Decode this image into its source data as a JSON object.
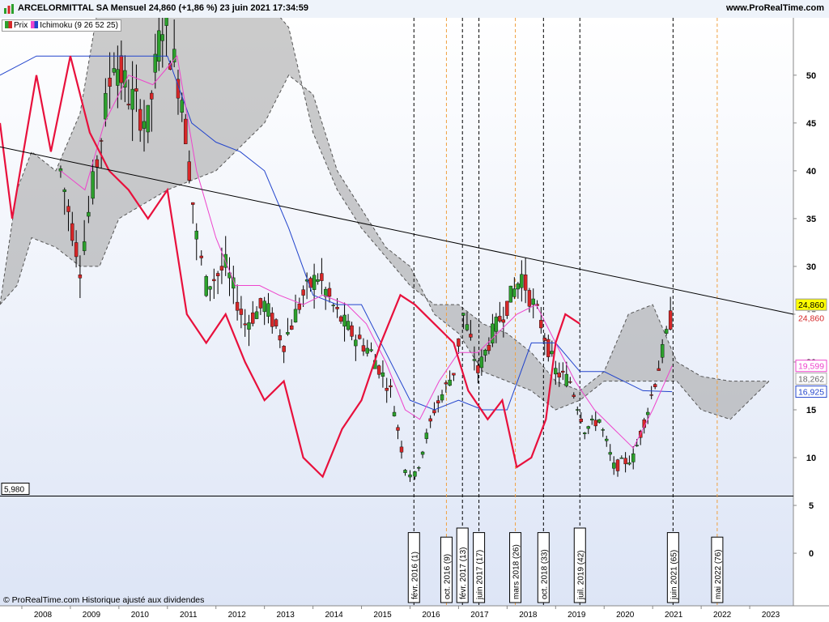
{
  "header": {
    "title": "ARCELORMITTAL SA Mensuel 24,860 (+1,86 %) 23 juin 2021 17:34:59",
    "site": "www.ProRealTime.com",
    "copyright": "© ProRealTime.com Historique ajusté aux dividendes"
  },
  "legend": {
    "price": "Prix",
    "ichimoku": "Ichimoku (9 26 52 25)"
  },
  "colors": {
    "up": "#2ca02c",
    "down": "#d62728",
    "tenkan": "#ee44cc",
    "kijun": "#2244cc",
    "chikou": "#e8103c",
    "cloud": "#a0a0a0",
    "trendline": "#000000",
    "vline": "#000000",
    "vline_future": "#f0a040"
  },
  "chart_data": {
    "type": "candlestick",
    "title": "ARCELORMITTAL SA Mensuel",
    "y_axis": {
      "range": [
        -5.5,
        56
      ],
      "ticks": [
        0,
        5,
        10,
        15,
        20,
        25,
        30,
        35,
        40,
        45,
        50
      ]
    },
    "x_axis": {
      "range": [
        2007.55,
        2023.9
      ],
      "ticks": [
        "2008",
        "2009",
        "2010",
        "2011",
        "2012",
        "2013",
        "2014",
        "2015",
        "2016",
        "2017",
        "2018",
        "2019",
        "2020",
        "2021",
        "2022",
        "2023"
      ]
    },
    "value_labels": [
      {
        "text": "24,860",
        "value": 26.0,
        "bg": "#ffff00",
        "fg": "#000000",
        "border": "#999999"
      },
      {
        "text": "24,860",
        "value": 24.6,
        "bg": "#ffffff",
        "fg": "#d62728",
        "border": "#ffffff"
      },
      {
        "text": "19,599",
        "value": 19.6,
        "bg": "#ffffff",
        "fg": "#ee44cc",
        "border": "#ee44cc"
      },
      {
        "text": "18,262",
        "value": 18.26,
        "bg": "#ffffff",
        "fg": "#666666",
        "border": "#aaaaaa"
      },
      {
        "text": "16,925",
        "value": 16.9,
        "bg": "#ffffff",
        "fg": "#2244cc",
        "border": "#2244cc"
      }
    ],
    "support": {
      "label": "5,980",
      "value": 5.98
    },
    "trendline": [
      [
        2007.55,
        42.5
      ],
      [
        2023.9,
        25.0
      ]
    ],
    "events": [
      {
        "label": "févr. 2016 (1)",
        "x": 2016.08,
        "future": false
      },
      {
        "label": "oct. 2016 (9)",
        "x": 2016.75,
        "future": true
      },
      {
        "label": "févr. 2017 (13)",
        "x": 2017.08,
        "future": false
      },
      {
        "label": "juin 2017 (17)",
        "x": 2017.42,
        "future": false
      },
      {
        "label": "mars 2018 (26)",
        "x": 2018.17,
        "future": true
      },
      {
        "label": "oct. 2018 (33)",
        "x": 2018.75,
        "future": false
      },
      {
        "label": "juil. 2019 (42)",
        "x": 2019.5,
        "future": false
      },
      {
        "label": "juin 2021 (65)",
        "x": 2021.42,
        "future": false
      },
      {
        "label": "mai 2022 (76)",
        "x": 2022.33,
        "future": true
      }
    ],
    "price_path": [
      [
        2008.8,
        40,
        3
      ],
      [
        2009.2,
        30,
        2
      ],
      [
        2009.9,
        52,
        3
      ],
      [
        2010.2,
        48,
        2
      ],
      [
        2010.6,
        45,
        2
      ],
      [
        2010.9,
        56,
        2
      ],
      [
        2011.3,
        48,
        2
      ],
      [
        2011.6,
        33,
        2
      ],
      [
        2011.8,
        28,
        2
      ],
      [
        2012.2,
        30,
        2
      ],
      [
        2012.6,
        24,
        2
      ],
      [
        2013.0,
        26,
        2
      ],
      [
        2013.4,
        22,
        2
      ],
      [
        2013.8,
        27,
        2
      ],
      [
        2014.1,
        29,
        2
      ],
      [
        2014.5,
        25,
        2
      ],
      [
        2014.8,
        23,
        2
      ],
      [
        2015.2,
        21,
        2
      ],
      [
        2015.6,
        17,
        2
      ],
      [
        2015.9,
        9,
        2
      ],
      [
        2016.1,
        8,
        2
      ],
      [
        2016.5,
        15,
        2
      ],
      [
        2016.9,
        19,
        2
      ],
      [
        2017.1,
        25,
        2
      ],
      [
        2017.4,
        19,
        2
      ],
      [
        2017.7,
        23,
        2
      ],
      [
        2018.0,
        26,
        2
      ],
      [
        2018.3,
        29,
        2
      ],
      [
        2018.7,
        24,
        2
      ],
      [
        2019.0,
        19,
        2
      ],
      [
        2019.3,
        18,
        2
      ],
      [
        2019.6,
        13,
        2
      ],
      [
        2019.9,
        14,
        2
      ],
      [
        2020.2,
        9,
        2
      ],
      [
        2020.6,
        10,
        2
      ],
      [
        2020.9,
        15,
        2
      ],
      [
        2021.2,
        21,
        2
      ],
      [
        2021.45,
        26,
        2
      ]
    ],
    "tenkan": [
      [
        2008.8,
        40
      ],
      [
        2009.3,
        38
      ],
      [
        2009.7,
        45
      ],
      [
        2010.2,
        50
      ],
      [
        2010.7,
        49
      ],
      [
        2011.2,
        52
      ],
      [
        2011.6,
        40
      ],
      [
        2012.0,
        33
      ],
      [
        2012.4,
        28
      ],
      [
        2012.9,
        28
      ],
      [
        2013.3,
        27
      ],
      [
        2013.8,
        26
      ],
      [
        2014.2,
        27
      ],
      [
        2014.7,
        26
      ],
      [
        2015.1,
        24
      ],
      [
        2015.5,
        20
      ],
      [
        2015.9,
        15
      ],
      [
        2016.2,
        14
      ],
      [
        2016.6,
        18
      ],
      [
        2017.0,
        21
      ],
      [
        2017.4,
        21
      ],
      [
        2017.8,
        23
      ],
      [
        2018.2,
        25
      ],
      [
        2018.6,
        26
      ],
      [
        2019.0,
        22
      ],
      [
        2019.4,
        18
      ],
      [
        2019.8,
        15
      ],
      [
        2020.2,
        13
      ],
      [
        2020.6,
        11
      ],
      [
        2021.0,
        15
      ],
      [
        2021.4,
        19.6
      ]
    ],
    "kijun": [
      [
        2007.55,
        50
      ],
      [
        2008.3,
        52
      ],
      [
        2009.0,
        52
      ],
      [
        2010.0,
        52
      ],
      [
        2011.0,
        52
      ],
      [
        2011.5,
        45
      ],
      [
        2012.0,
        43
      ],
      [
        2012.5,
        42
      ],
      [
        2013.0,
        40
      ],
      [
        2013.5,
        34
      ],
      [
        2014.0,
        27
      ],
      [
        2014.5,
        26
      ],
      [
        2015.0,
        26
      ],
      [
        2015.5,
        21
      ],
      [
        2016.0,
        16
      ],
      [
        2016.5,
        15
      ],
      [
        2017.0,
        16
      ],
      [
        2017.5,
        15
      ],
      [
        2018.0,
        15
      ],
      [
        2018.5,
        22
      ],
      [
        2019.0,
        22
      ],
      [
        2019.5,
        19
      ],
      [
        2020.0,
        19
      ],
      [
        2020.4,
        18
      ],
      [
        2020.8,
        17
      ],
      [
        2021.4,
        16.9
      ]
    ],
    "chikou": [
      [
        2007.55,
        45
      ],
      [
        2007.8,
        35
      ],
      [
        2008.3,
        50
      ],
      [
        2008.6,
        42
      ],
      [
        2009.0,
        52
      ],
      [
        2009.4,
        44
      ],
      [
        2009.8,
        40
      ],
      [
        2010.2,
        38
      ],
      [
        2010.6,
        35
      ],
      [
        2011.0,
        38
      ],
      [
        2011.4,
        25
      ],
      [
        2011.8,
        22
      ],
      [
        2012.2,
        25
      ],
      [
        2012.6,
        20
      ],
      [
        2013.0,
        16
      ],
      [
        2013.4,
        18
      ],
      [
        2013.8,
        10
      ],
      [
        2014.2,
        8
      ],
      [
        2014.6,
        13
      ],
      [
        2015.0,
        16
      ],
      [
        2015.4,
        22
      ],
      [
        2015.8,
        27
      ],
      [
        2016.1,
        26
      ],
      [
        2016.5,
        24
      ],
      [
        2016.9,
        22
      ],
      [
        2017.2,
        17
      ],
      [
        2017.6,
        14
      ],
      [
        2017.9,
        16
      ],
      [
        2018.2,
        9
      ],
      [
        2018.5,
        10
      ],
      [
        2018.8,
        14
      ],
      [
        2019.0,
        22
      ],
      [
        2019.2,
        25
      ],
      [
        2019.5,
        24
      ]
    ],
    "cloud_upper": [
      [
        2007.55,
        26
      ],
      [
        2007.9,
        38
      ],
      [
        2008.2,
        42
      ],
      [
        2008.7,
        40
      ],
      [
        2009.2,
        46
      ],
      [
        2009.6,
        58
      ],
      [
        2010.0,
        58
      ],
      [
        2011.0,
        58
      ],
      [
        2012.0,
        58
      ],
      [
        2013.0,
        58
      ],
      [
        2013.5,
        55
      ],
      [
        2014.0,
        44
      ],
      [
        2014.5,
        38
      ],
      [
        2015.0,
        34
      ],
      [
        2015.5,
        31
      ],
      [
        2016.0,
        28
      ],
      [
        2016.5,
        26
      ],
      [
        2017.0,
        26
      ],
      [
        2017.5,
        24
      ],
      [
        2018.0,
        23
      ],
      [
        2018.5,
        21
      ],
      [
        2019.0,
        18
      ],
      [
        2019.5,
        17
      ],
      [
        2020.0,
        19
      ],
      [
        2020.5,
        25
      ],
      [
        2021.0,
        26
      ],
      [
        2021.5,
        20
      ],
      [
        2022.0,
        18.5
      ],
      [
        2022.6,
        18
      ],
      [
        2023.4,
        18
      ]
    ],
    "cloud_lower": [
      [
        2007.55,
        26
      ],
      [
        2007.9,
        28
      ],
      [
        2008.2,
        33
      ],
      [
        2008.7,
        32
      ],
      [
        2009.2,
        30
      ],
      [
        2009.6,
        30
      ],
      [
        2010.0,
        35
      ],
      [
        2011.0,
        38
      ],
      [
        2012.0,
        40
      ],
      [
        2013.0,
        45
      ],
      [
        2013.5,
        50
      ],
      [
        2014.0,
        48
      ],
      [
        2014.5,
        40
      ],
      [
        2015.0,
        36
      ],
      [
        2015.5,
        32
      ],
      [
        2016.0,
        30
      ],
      [
        2016.5,
        25
      ],
      [
        2017.0,
        23
      ],
      [
        2017.5,
        19
      ],
      [
        2018.0,
        18
      ],
      [
        2018.5,
        17
      ],
      [
        2019.0,
        15
      ],
      [
        2019.5,
        16
      ],
      [
        2020.0,
        18
      ],
      [
        2020.5,
        18
      ],
      [
        2021.0,
        18
      ],
      [
        2021.5,
        18
      ],
      [
        2022.0,
        15
      ],
      [
        2022.6,
        14
      ],
      [
        2023.4,
        18
      ]
    ]
  }
}
